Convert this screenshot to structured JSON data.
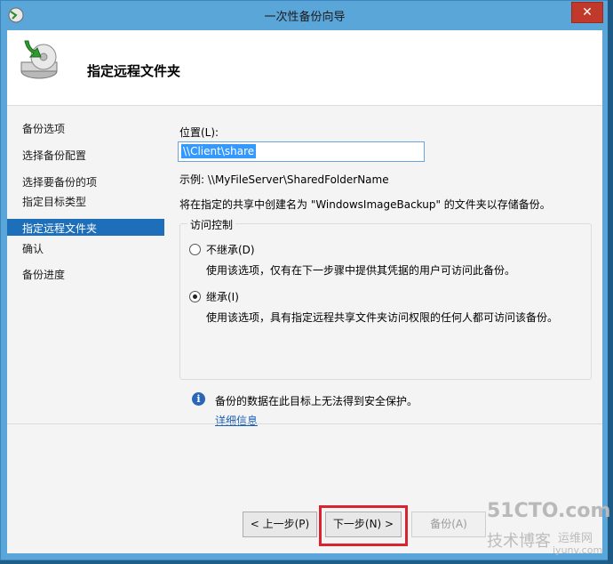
{
  "window": {
    "title": "一次性备份向导",
    "close_label": "✕"
  },
  "header": {
    "title": "指定远程文件夹"
  },
  "sidebar": {
    "items": [
      {
        "label": "备份选项"
      },
      {
        "label": "选择备份配置"
      },
      {
        "label": "选择要备份的项"
      },
      {
        "label": "指定目标类型"
      },
      {
        "label": "指定远程文件夹"
      },
      {
        "label": "确认"
      },
      {
        "label": "备份进度"
      }
    ],
    "selected_index": 4
  },
  "main": {
    "location_label": "位置(L):",
    "location_value": "\\\\Client\\share",
    "example": "示例: \\\\MyFileServer\\SharedFolderName",
    "info": "将在指定的共享中创建名为 \"WindowsImageBackup\" 的文件夹以存储备份。",
    "access": {
      "title": "访问控制",
      "options": [
        {
          "label": "不继承(D)",
          "desc": "使用该选项，仅有在下一步骤中提供其凭据的用户可访问此备份。",
          "selected": false
        },
        {
          "label": "继承(I)",
          "desc": "使用该选项，具有指定远程共享文件夹访问权限的任何人都可访问该备份。",
          "selected": true
        }
      ]
    },
    "notice": {
      "icon": "info-icon",
      "text": "备份的数据在此目标上无法得到安全保护。",
      "link": "详细信息"
    }
  },
  "footer": {
    "back_label": "< 上一步(P)",
    "next_label": "下一步(N) >",
    "backup_label": "备份(A)"
  },
  "watermark": {
    "line1": "51CTO.com",
    "line2": "技术博客",
    "line3": "运维网",
    "line4": "iyunv.com"
  },
  "colors": {
    "selected_bg": "#1e6fba",
    "highlight": "#d9232f"
  }
}
